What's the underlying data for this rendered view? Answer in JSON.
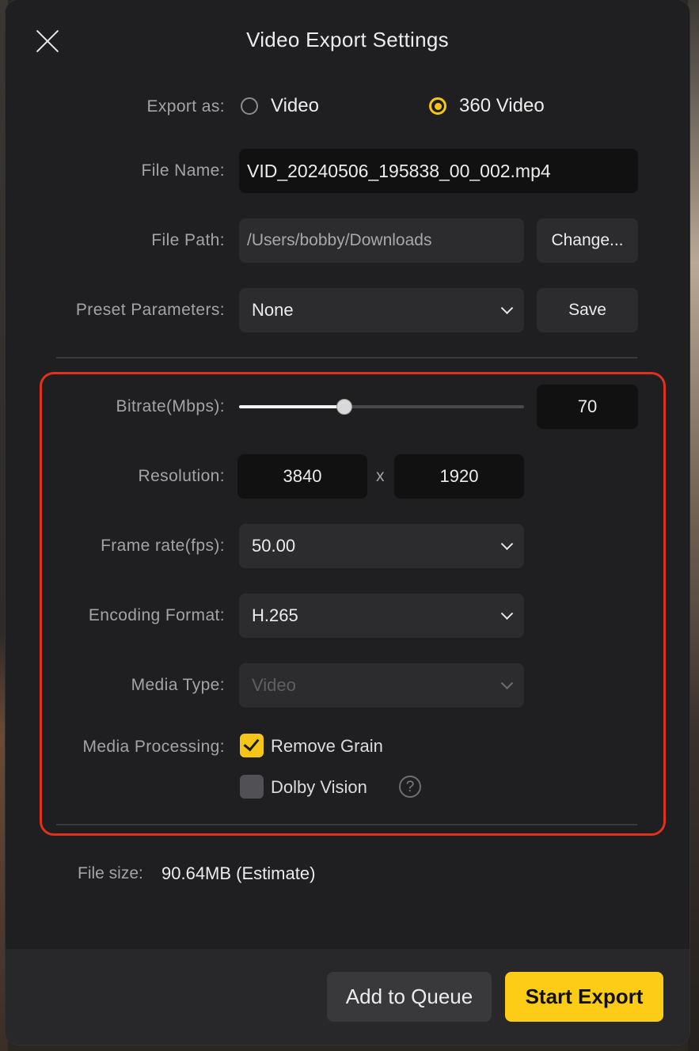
{
  "dialog": {
    "title": "Video Export Settings"
  },
  "export_as": {
    "label": "Export as:",
    "options": [
      {
        "label": "Video",
        "selected": false
      },
      {
        "label": "360 Video",
        "selected": true
      }
    ]
  },
  "file_name": {
    "label": "File Name:",
    "value": "VID_20240506_195838_00_002.mp4"
  },
  "file_path": {
    "label": "File Path:",
    "value": "/Users/bobby/Downloads",
    "change_button": "Change..."
  },
  "preset": {
    "label": "Preset Parameters:",
    "value": "None",
    "save_button": "Save"
  },
  "bitrate": {
    "label": "Bitrate(Mbps):",
    "value": "70",
    "slider_fraction": 0.37
  },
  "resolution": {
    "label": "Resolution:",
    "width": "3840",
    "separator": "x",
    "height": "1920"
  },
  "frame_rate": {
    "label": "Frame rate(fps):",
    "value": "50.00"
  },
  "encoding": {
    "label": "Encoding Format:",
    "value": "H.265"
  },
  "media_type": {
    "label": "Media Type:",
    "value": "Video",
    "disabled": true
  },
  "media_processing": {
    "label": "Media Processing:",
    "options": [
      {
        "label": "Remove Grain",
        "checked": true
      },
      {
        "label": "Dolby Vision",
        "checked": false
      }
    ],
    "help_glyph": "?"
  },
  "file_size": {
    "label": "File size:",
    "value": "90.64MB (Estimate)"
  },
  "footer": {
    "queue_button": "Add to Queue",
    "export_button": "Start Export"
  },
  "colors": {
    "accent": "#fccc16",
    "highlight_border": "#e0301e",
    "dialog_bg": "#1f1f21"
  }
}
